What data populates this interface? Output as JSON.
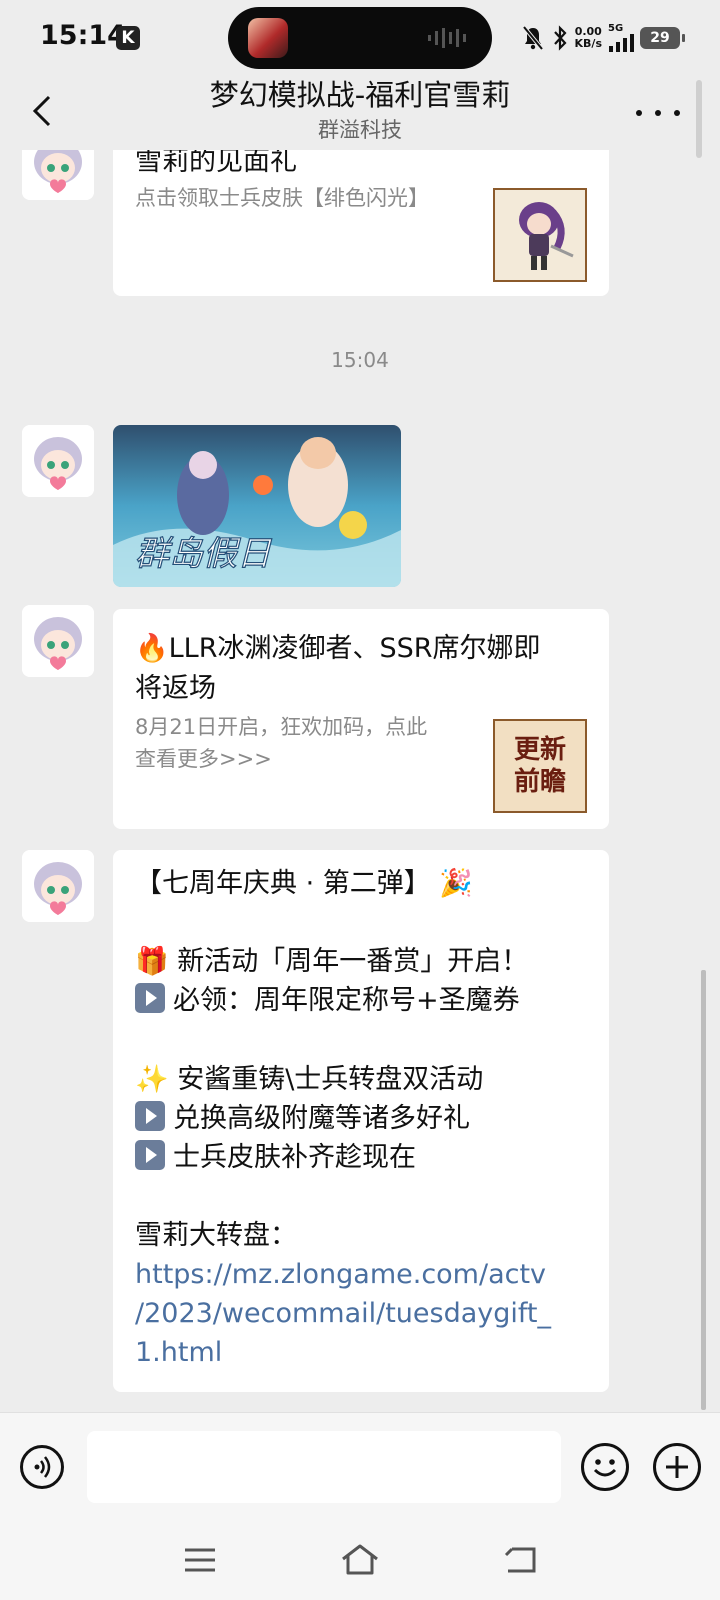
{
  "status_bar": {
    "time": "15:14",
    "app_badge": "K",
    "net_speed_value": "0.00",
    "net_speed_unit": "KB/s",
    "network": "5G",
    "battery": "29"
  },
  "header": {
    "title": "梦幻模拟战-福利官雪莉",
    "subtitle": "群溢科技"
  },
  "messages": [
    {
      "type": "link_card",
      "title": "雪莉的见面礼",
      "description": "点击领取士兵皮肤【绯色闪光】",
      "thumbnail": "chibi-character-image"
    },
    {
      "type": "timestamp",
      "text": "15:04"
    },
    {
      "type": "image",
      "image_text": "群岛假日"
    },
    {
      "type": "link_card",
      "title_line1": "🔥LLR冰渊凌御者、SSR席尔娜即",
      "title_line2": "将返场",
      "desc_line1": "8月21日开启，狂欢加码，点此",
      "desc_line2": "查看更多>>>",
      "thumb_text_line1": "更新",
      "thumb_text_line2": "前瞻"
    },
    {
      "type": "text",
      "line1": "【七周年庆典 · 第二弹】 🎉",
      "line2": "🎁 新活动「周年一番赏」开启！",
      "line3": "必领：周年限定称号+圣魔券",
      "line4": "✨ 安酱重铸\\士兵转盘双活动",
      "line5": "兑换高级附魔等诸多好礼",
      "line6": "士兵皮肤补齐趁现在",
      "line7": "雪莉大转盘：",
      "link_line1": "https://mz.zlongame.com/actv",
      "link_line2": "/2023/wecommail/tuesdaygift_",
      "link_line3": "1.html"
    }
  ],
  "input": {
    "value": "",
    "placeholder": ""
  },
  "colors": {
    "background": "#ededed",
    "bubble": "#ffffff",
    "link": "#4a6fa0",
    "secondary_text": "#8a8a8a"
  }
}
